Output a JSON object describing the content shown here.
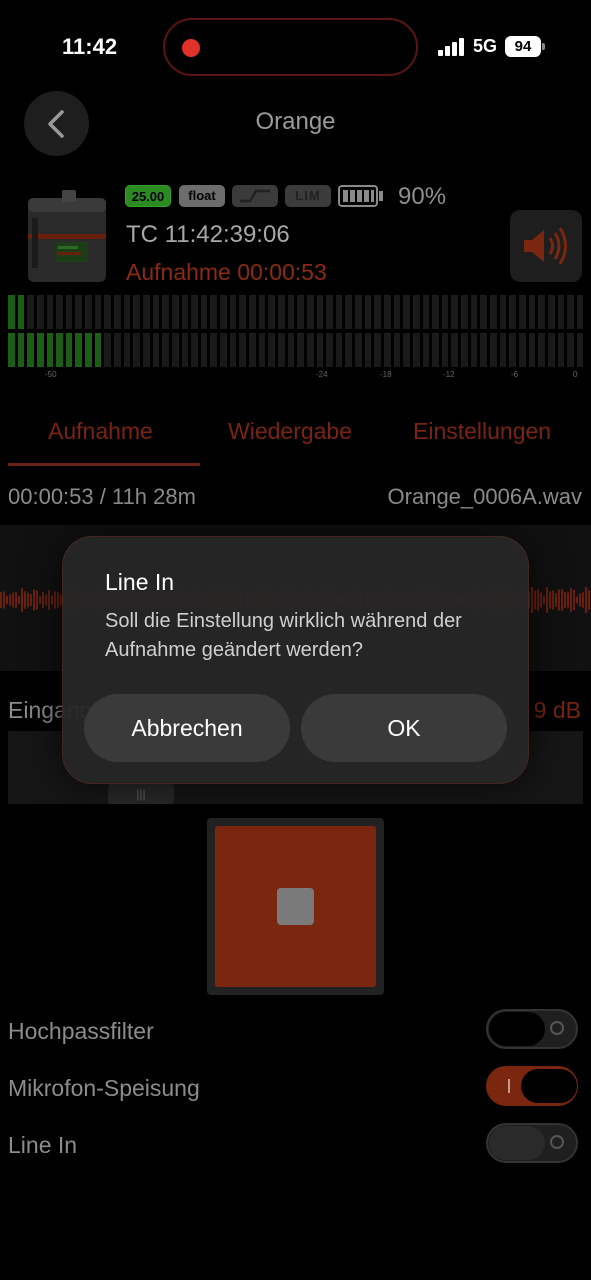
{
  "status_bar": {
    "time": "11:42",
    "network": "5G",
    "battery": "94"
  },
  "header": {
    "title": "Orange"
  },
  "device": {
    "frame_rate": "25.00",
    "format": "float",
    "limiter": "LIM",
    "battery_percent": "90%",
    "timecode": "TC 11:42:39:06",
    "recording_time": "Aufnahme 00:00:53"
  },
  "meter": {
    "scale": [
      "-50",
      "-24",
      "-18",
      "-12",
      "-6",
      "0"
    ],
    "levels": [
      0.03,
      0.17
    ]
  },
  "tabs": [
    "Aufnahme",
    "Wiedergabe",
    "Einstellungen"
  ],
  "recording": {
    "elapsed_remaining": "00:00:53 / 11h 28m",
    "filename": "Orange_0006A.wav"
  },
  "gain": {
    "label": "Eingangspegel",
    "value": "9 dB",
    "handle_glyph": "|||"
  },
  "toggles": [
    {
      "label": "Hochpassfilter",
      "state": "off"
    },
    {
      "label": "Mikrofon-Speisung",
      "state": "on"
    },
    {
      "label": "Line In",
      "state": "off"
    }
  ],
  "dialog": {
    "title": "Line In",
    "message": "Soll die Einstellung wirklich während der Aufnahme geändert werden?",
    "cancel_label": "Abbrechen",
    "ok_label": "OK"
  },
  "colors": {
    "accent": "#7b2710",
    "meter_green": "#1d5e16",
    "recording_red": "#e0322a"
  }
}
